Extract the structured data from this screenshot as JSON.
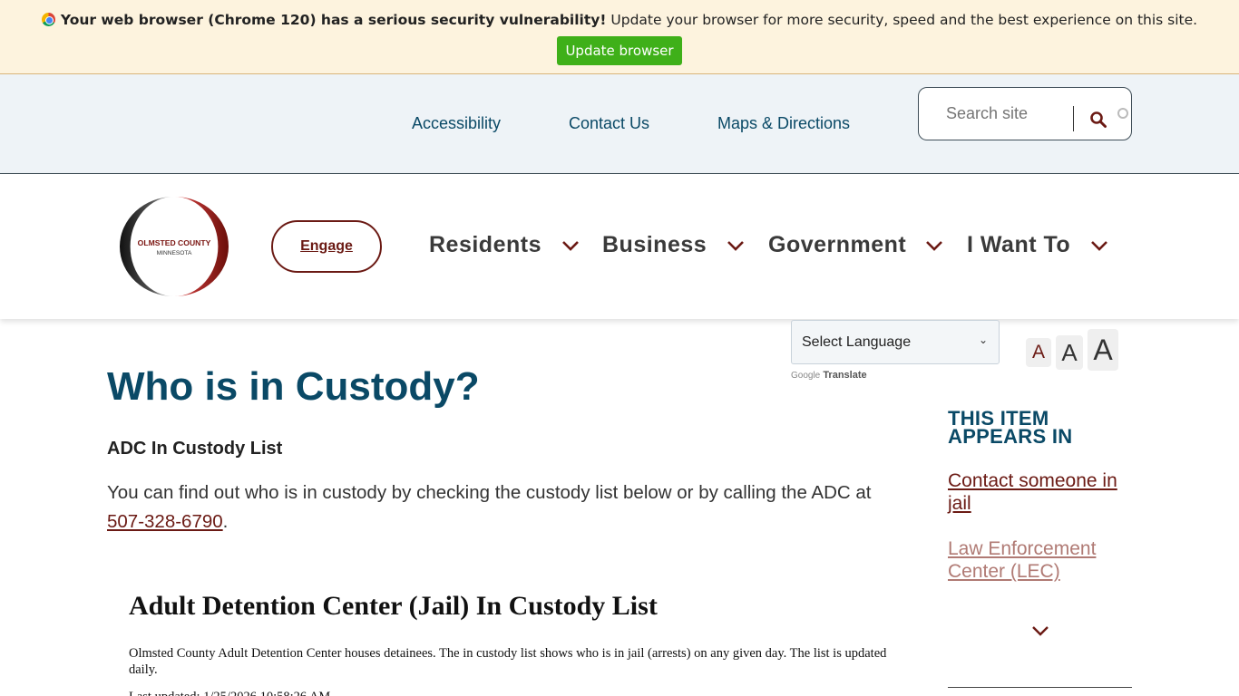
{
  "browser_warning": {
    "bold_text": "Your web browser (Chrome 120) has a serious security vulnerability!",
    "text": " Update your browser for more security, speed and the best experience on this site.",
    "button_label": "Update browser",
    "button_color": "#3fb019"
  },
  "utility_nav": {
    "links": [
      "Accessibility",
      "Contact Us",
      "Maps & Directions"
    ],
    "search_placeholder": "Search site"
  },
  "header": {
    "logo_line1": "OLMSTED COUNTY",
    "logo_line2": "MINNESOTA",
    "engage_label": "Engage",
    "nav": [
      "Residents",
      "Business",
      "Government",
      "I Want To"
    ]
  },
  "language": {
    "selected": "Select Language",
    "powered_google": "Google",
    "powered_translate": "Translate"
  },
  "text_size": [
    "A",
    "A",
    "A"
  ],
  "content": {
    "title": "Who is in Custody?",
    "subheading": "ADC In Custody List",
    "intro_text": "You can find out who is in custody by checking the custody list below or by calling the ADC at ",
    "phone": "507-328-6790",
    "intro_end": ".",
    "embed_title": "Adult Detention Center (Jail) In Custody List",
    "embed_desc": "Olmsted County Adult Detention Center houses detainees. The in custody list shows who is in jail (arrests) on any given day.  The list is updated daily.",
    "embed_updated": "Last updated: 1/25/2026 10:58:26 AM"
  },
  "sidebar": {
    "heading": "THIS ITEM APPEARS IN",
    "links": [
      "Contact someone in jail",
      "Law Enforcement Center (LEC)"
    ]
  },
  "colors": {
    "brand_blue": "#0a4966",
    "brand_maroon": "#6b1a14",
    "banner_bg": "#fdf3de",
    "utility_bg": "#eef3f7"
  }
}
